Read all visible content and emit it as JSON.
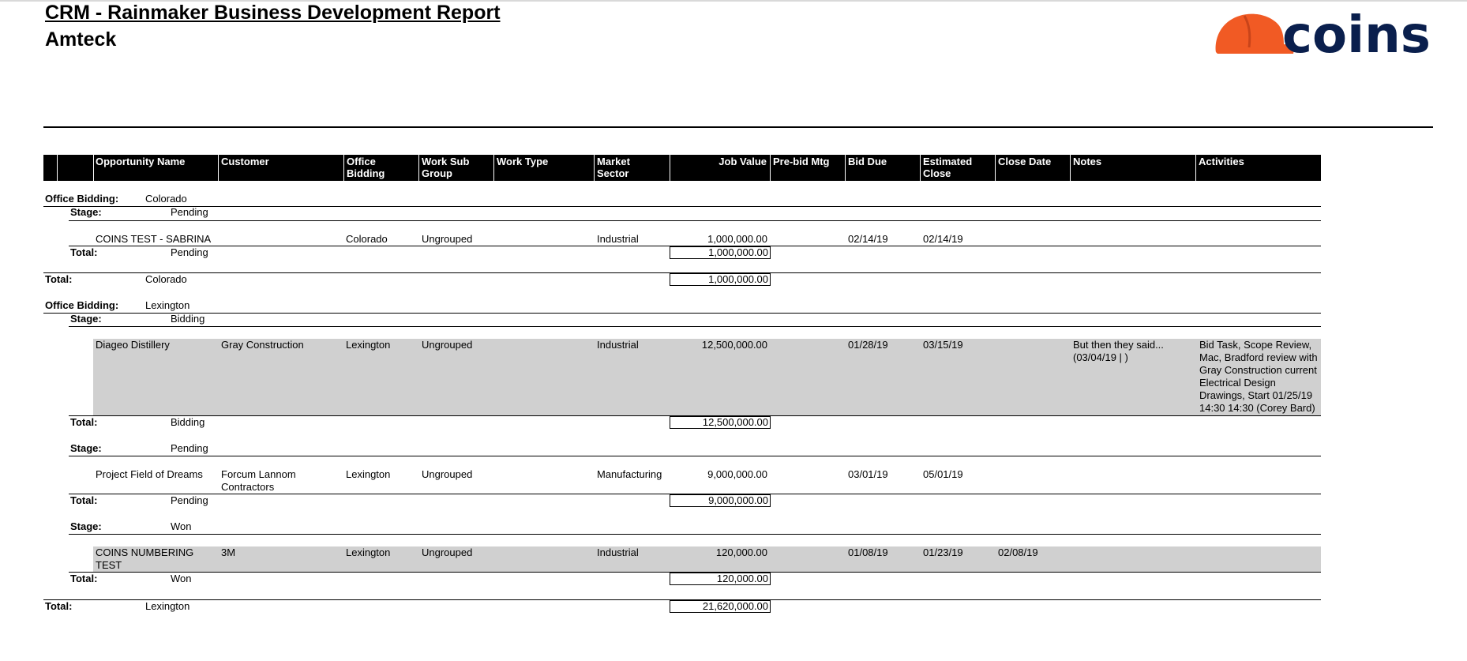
{
  "report": {
    "title": "CRM - Rainmaker Business Development Report",
    "company": "Amteck",
    "logo_text": "coins"
  },
  "colors": {
    "header_bg": "#000000",
    "row_highlight": "#d0d0d0",
    "logo_helmet": "#f15a24",
    "logo_text": "#0a1f4d"
  },
  "columns": [
    "Opportunity Name",
    "Customer",
    "Office Bidding",
    "Work Sub Group",
    "Work Type",
    "Market Sector",
    "Job Value",
    "Pre-bid Mtg",
    "Bid Due",
    "Estimated Close",
    "Close Date",
    "Notes",
    "Activities"
  ],
  "labels": {
    "office_bidding": "Office Bidding:",
    "stage": "Stage:",
    "total": "Total:"
  },
  "groups": [
    {
      "office": "Colorado",
      "stages": [
        {
          "stage": "Pending",
          "rows": [
            {
              "name": "COINS TEST - SABRINA",
              "customer": "",
              "office": "Colorado",
              "sub_group": "Ungrouped",
              "work_type": "",
              "sector": "Industrial",
              "job_value": "1,000,000.00",
              "prebid": "",
              "bid_due": "02/14/19",
              "est_close": "02/14/19",
              "close_date": "",
              "notes": "",
              "activities": ""
            }
          ],
          "total": "1,000,000.00"
        }
      ],
      "total": "1,000,000.00"
    },
    {
      "office": "Lexington",
      "stages": [
        {
          "stage": "Bidding",
          "rows": [
            {
              "name": "Diageo Distillery",
              "customer": "Gray Construction",
              "office": "Lexington",
              "sub_group": "Ungrouped",
              "work_type": "",
              "sector": "Industrial",
              "job_value": "12,500,000.00",
              "prebid": "",
              "bid_due": "01/28/19",
              "est_close": "03/15/19",
              "close_date": "",
              "notes": "But then they said... (03/04/19 | )",
              "activities": "Bid Task, Scope Review, Mac, Bradford review with Gray Construction current Electrical Design Drawings, Start 01/25/19 14:30 14:30 (Corey Bard)"
            }
          ],
          "total": "12,500,000.00"
        },
        {
          "stage": "Pending",
          "rows": [
            {
              "name": "Project Field of Dreams",
              "customer": "Forcum Lannom Contractors",
              "office": "Lexington",
              "sub_group": "Ungrouped",
              "work_type": "",
              "sector": "Manufacturing",
              "job_value": "9,000,000.00",
              "prebid": "",
              "bid_due": "03/01/19",
              "est_close": "05/01/19",
              "close_date": "",
              "notes": "",
              "activities": ""
            }
          ],
          "total": "9,000,000.00"
        },
        {
          "stage": "Won",
          "rows": [
            {
              "name": "COINS NUMBERING TEST",
              "customer": "3M",
              "office": "Lexington",
              "sub_group": "Ungrouped",
              "work_type": "",
              "sector": "Industrial",
              "job_value": "120,000.00",
              "prebid": "",
              "bid_due": "01/08/19",
              "est_close": "01/23/19",
              "close_date": "02/08/19",
              "notes": "",
              "activities": ""
            }
          ],
          "total": "120,000.00"
        }
      ],
      "total": "21,620,000.00"
    }
  ]
}
